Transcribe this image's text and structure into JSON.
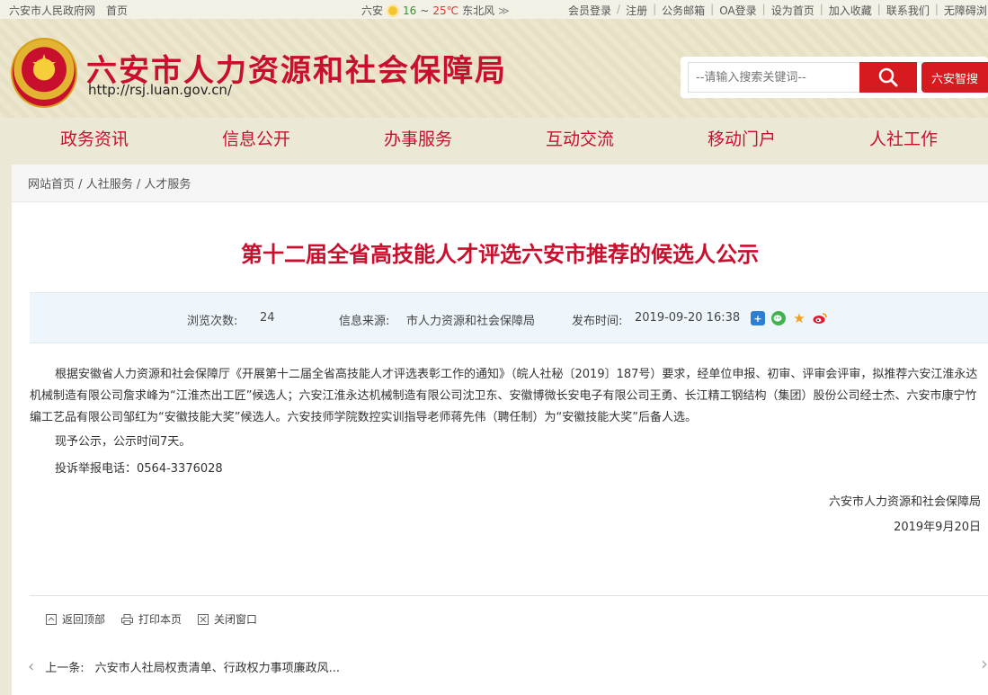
{
  "topbar": {
    "gov_link": "六安市人民政府网",
    "home_link": "首页",
    "weather_city": "六安",
    "weather_low": "16",
    "weather_sep": "~",
    "weather_high": "25℃",
    "weather_wind": "东北风",
    "weather_more": "≫",
    "member_login": "会员登录",
    "register": "注册",
    "mail": "公务邮箱",
    "oa_login": "OA登录",
    "set_home": "设为首页",
    "add_fav": "加入收藏",
    "contact": "联系我们",
    "accessible": "无障碍浏览"
  },
  "header": {
    "site_title": "六安市人力资源和社会保障局",
    "site_url": "http://rsj.luan.gov.cn/",
    "seal_text": "人事章",
    "search_placeholder": "--请输入搜索关键词--",
    "zhisou_label": "六安智搜"
  },
  "nav": {
    "items": [
      "政务资讯",
      "信息公开",
      "办事服务",
      "互动交流",
      "移动门户",
      "人社工作"
    ]
  },
  "breadcrumb": {
    "home": "网站首页",
    "sep": "/",
    "level1": "人社服务",
    "level2": "人才服务"
  },
  "article": {
    "title": "第十二届全省高技能人才评选六安市推荐的候选人公示",
    "views_label": "浏览次数:",
    "views_value": "24",
    "source_label": "信息来源:",
    "source_value": "市人力资源和社会保障局",
    "date_label": "发布时间:",
    "date_value": "2019-09-20 16:38",
    "paragraph1": "根据安徽省人力资源和社会保障厅《开展第十二届全省高技能人才评选表彰工作的通知》（皖人社秘〔2019〕187号）要求，经单位申报、初审、评审会评审，拟推荐六安江淮永达机械制造有限公司詹求峰为“江淮杰出工匠”候选人；六安江淮永达机械制造有限公司沈卫东、安徽博微长安电子有限公司王勇、长江精工钢结构（集团）股份公司经士杰、六安市康宁竹编工艺品有限公司邹红为“安徽技能大奖”候选人。六安技师学院数控实训指导老师蒋先伟（聘任制）为“安徽技能大奖”后备人选。",
    "paragraph2": "现予公示，公示时间7天。",
    "paragraph3": "投诉举报电话：0564-3376028",
    "signature": "六安市人力资源和社会保障局",
    "sign_date": "2019年9月20日"
  },
  "actions": {
    "back_top": "返回顶部",
    "print": "打印本页",
    "close": "关闭窗口"
  },
  "pager": {
    "prev_label": "上一条:",
    "prev_title": "六安市人社局权责清单、行政权力事项廉政风..."
  },
  "colors": {
    "brand_red": "#c8102e",
    "search_red": "#d71920",
    "meta_bg": "#eef6fb"
  }
}
